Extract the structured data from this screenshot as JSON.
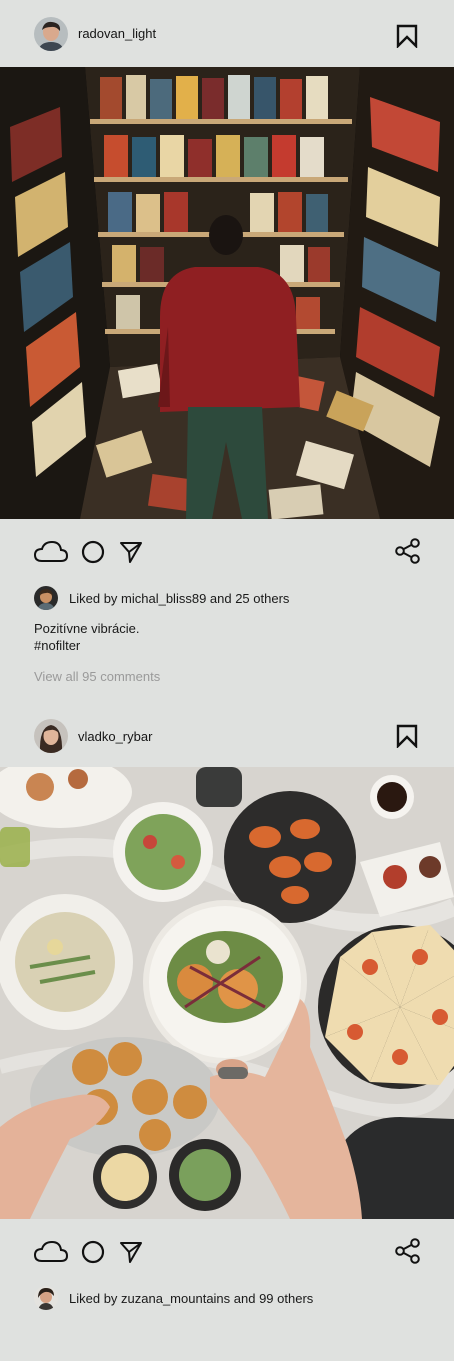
{
  "posts": [
    {
      "username": "radovan_light",
      "likes_text": "Liked by michal_bliss89 and 25 others",
      "caption_line1": "Pozitívne vibrácie.",
      "caption_line2": "#nofilter",
      "comments_link": "View all 95 comments",
      "photo": "comic-bookstore-illustration"
    },
    {
      "username": "vladko_rybar",
      "likes_text": "Liked by zuzana_mountains and 99 others",
      "photo": "food-table-overhead"
    }
  ],
  "icons": {
    "bookmark": "bookmark-icon",
    "like": "cloud-icon",
    "comment": "circle-icon",
    "send": "send-icon",
    "share": "share-icon"
  },
  "colors": {
    "background": "#dfe1df",
    "text": "#1a1a1a",
    "muted": "#9a9a9a"
  }
}
